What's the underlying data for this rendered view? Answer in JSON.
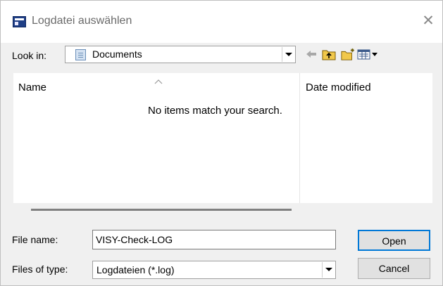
{
  "window": {
    "title": "Logdatei auswählen",
    "close_glyph": "✕"
  },
  "lookin": {
    "label": "Look in:",
    "value": "Documents"
  },
  "toolbar": {
    "back_icon": "back-arrow-icon",
    "up_icon": "up-folder-icon",
    "new_folder_icon": "new-folder-icon",
    "view_icon": "view-menu-icon"
  },
  "list": {
    "columns": [
      "Name",
      "Date modified"
    ],
    "empty_message": "No items match your search."
  },
  "filename": {
    "label": "File name:",
    "value": "VISY-Check-LOG"
  },
  "filetype": {
    "label": "Files of type:",
    "value": "Logdateien (*.log)"
  },
  "buttons": {
    "open": "Open",
    "cancel": "Cancel"
  }
}
